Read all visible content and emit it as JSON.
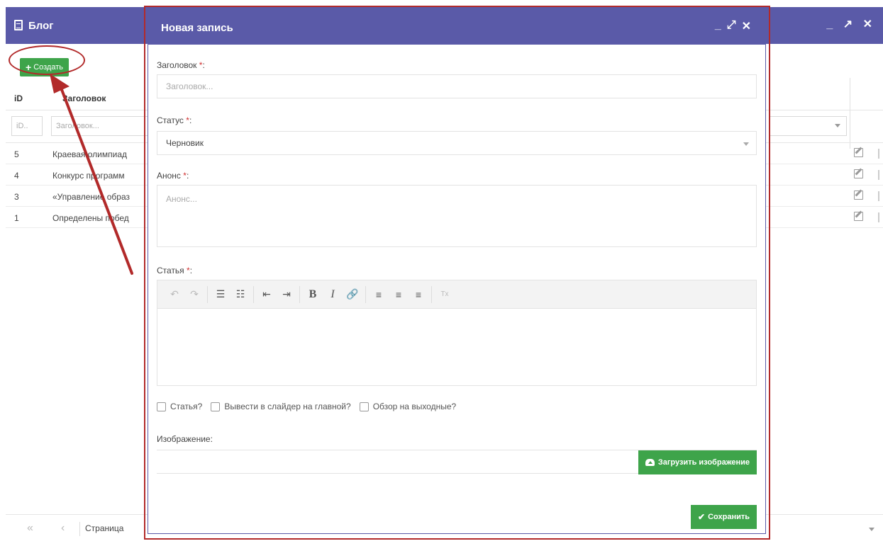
{
  "background_window": {
    "title": "Блог",
    "controls": [
      "_",
      "↗",
      "✕"
    ],
    "create_button_label": "Создать",
    "columns": {
      "id": "iD",
      "title": "Заголовок"
    },
    "filters": {
      "id_placeholder": "iD..",
      "title_placeholder": "Заголовок..."
    },
    "rows": [
      {
        "id": "5",
        "title": "Краевая олимпиад"
      },
      {
        "id": "4",
        "title": "Конкурс программ"
      },
      {
        "id": "3",
        "title": "«Управление образ"
      },
      {
        "id": "1",
        "title": "Определены побед"
      }
    ],
    "pager": {
      "first": "«",
      "prev": "‹",
      "page_label": "Страница"
    }
  },
  "modal": {
    "title": "Новая запись",
    "controls": [
      "_",
      "⤢",
      "✕"
    ],
    "fields": {
      "heading": {
        "label": "Заголовок",
        "required_mark": "*",
        "colon": ":",
        "placeholder": "Заголовок..."
      },
      "status": {
        "label": "Статус",
        "required_mark": "*",
        "colon": ":",
        "value": "Черновик"
      },
      "announce": {
        "label": "Анонс",
        "required_mark": "*",
        "colon": ":",
        "placeholder": "Анонс..."
      },
      "article": {
        "label": "Статья",
        "required_mark": "*",
        "colon": ":"
      }
    },
    "toolbar": {
      "undo": "↶",
      "redo": "↷",
      "bullet_list": "☰",
      "numbered_list": "☷",
      "outdent": "⇤",
      "indent": "⇥",
      "bold": "B",
      "italic": "I",
      "link": "🔗",
      "align_left": "≡",
      "align_center": "≡",
      "align_right": "≡",
      "clear_format": "Tx"
    },
    "checkboxes": [
      {
        "label": "Статья?"
      },
      {
        "label": "Вывести в слайдер на главной?"
      },
      {
        "label": "Обзор на выходные?"
      }
    ],
    "image_label": "Изображение:",
    "upload_button_label": "Загрузить изображение",
    "save_button_label": "Сохранить"
  },
  "colors": {
    "header_bg": "#5a5aa8",
    "button_green": "#3ea44a",
    "annotation_red": "#b22a2a"
  }
}
